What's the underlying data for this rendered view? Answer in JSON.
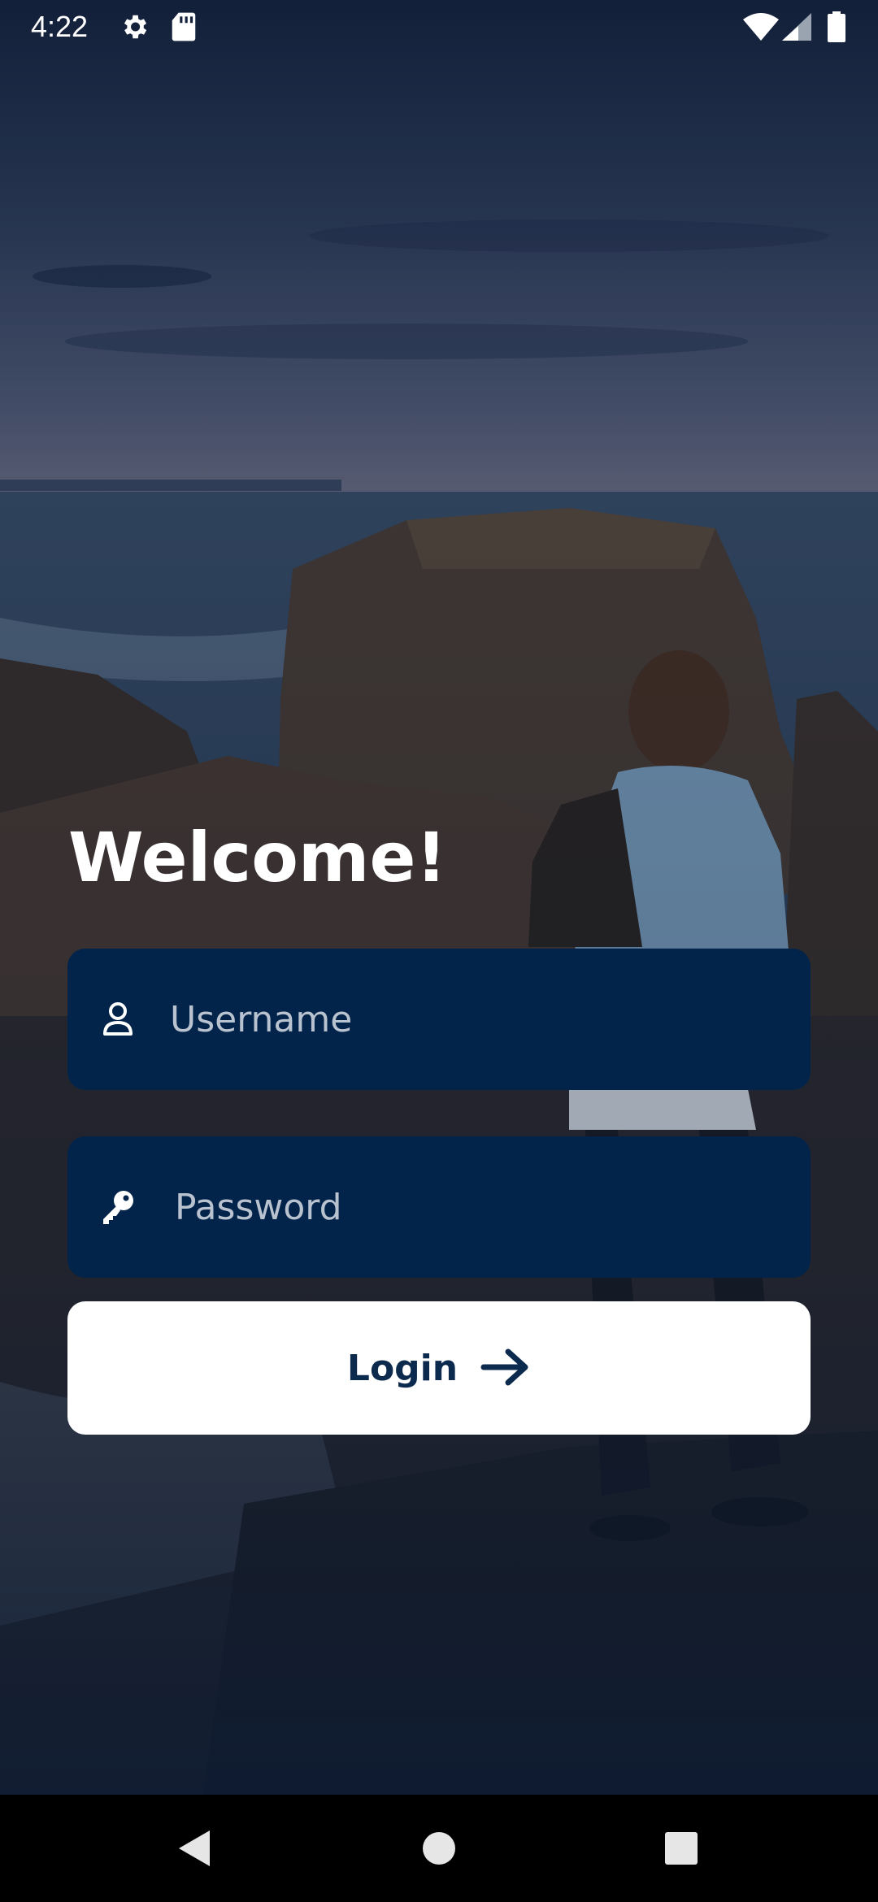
{
  "status_bar": {
    "time": "4:22",
    "icons": [
      "settings-icon",
      "sd-card-icon",
      "wifi-icon",
      "signal-icon",
      "battery-icon"
    ]
  },
  "welcome": {
    "title": "Welcome!"
  },
  "form": {
    "username": {
      "placeholder": "Username",
      "value": "",
      "icon": "person-icon"
    },
    "password": {
      "placeholder": "Password",
      "value": "",
      "icon": "key-icon"
    },
    "login_button": {
      "label": "Login",
      "icon": "arrow-right-icon"
    }
  },
  "colors": {
    "field_background": "#03244a",
    "button_background": "#ffffff",
    "button_text": "#0b2a4d",
    "title_text": "#ffffff"
  },
  "nav_bar": {
    "buttons": [
      "back-icon",
      "home-icon",
      "recents-icon"
    ]
  }
}
